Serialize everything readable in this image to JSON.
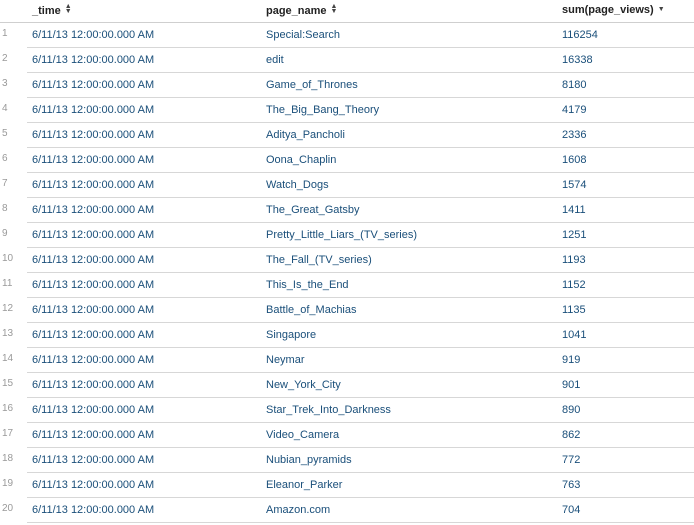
{
  "table": {
    "columns": [
      {
        "label": "_time",
        "sort": "both"
      },
      {
        "label": "page_name",
        "sort": "both"
      },
      {
        "label": "sum(page_views)",
        "sort": "desc"
      }
    ],
    "rows": [
      {
        "num": "1",
        "time": "6/11/13 12:00:00.000 AM",
        "page_name": "Special:Search",
        "views": "116254"
      },
      {
        "num": "2",
        "time": "6/11/13 12:00:00.000 AM",
        "page_name": "edit",
        "views": "16338"
      },
      {
        "num": "3",
        "time": "6/11/13 12:00:00.000 AM",
        "page_name": "Game_of_Thrones",
        "views": "8180"
      },
      {
        "num": "4",
        "time": "6/11/13 12:00:00.000 AM",
        "page_name": "The_Big_Bang_Theory",
        "views": "4179"
      },
      {
        "num": "5",
        "time": "6/11/13 12:00:00.000 AM",
        "page_name": "Aditya_Pancholi",
        "views": "2336"
      },
      {
        "num": "6",
        "time": "6/11/13 12:00:00.000 AM",
        "page_name": "Oona_Chaplin",
        "views": "1608"
      },
      {
        "num": "7",
        "time": "6/11/13 12:00:00.000 AM",
        "page_name": "Watch_Dogs",
        "views": "1574"
      },
      {
        "num": "8",
        "time": "6/11/13 12:00:00.000 AM",
        "page_name": "The_Great_Gatsby",
        "views": "1411"
      },
      {
        "num": "9",
        "time": "6/11/13 12:00:00.000 AM",
        "page_name": "Pretty_Little_Liars_(TV_series)",
        "views": "1251"
      },
      {
        "num": "10",
        "time": "6/11/13 12:00:00.000 AM",
        "page_name": "The_Fall_(TV_series)",
        "views": "1193"
      },
      {
        "num": "11",
        "time": "6/11/13 12:00:00.000 AM",
        "page_name": "This_Is_the_End",
        "views": "1152"
      },
      {
        "num": "12",
        "time": "6/11/13 12:00:00.000 AM",
        "page_name": "Battle_of_Machias",
        "views": "1135"
      },
      {
        "num": "13",
        "time": "6/11/13 12:00:00.000 AM",
        "page_name": "Singapore",
        "views": "1041"
      },
      {
        "num": "14",
        "time": "6/11/13 12:00:00.000 AM",
        "page_name": "Neymar",
        "views": "919"
      },
      {
        "num": "15",
        "time": "6/11/13 12:00:00.000 AM",
        "page_name": "New_York_City",
        "views": "901"
      },
      {
        "num": "16",
        "time": "6/11/13 12:00:00.000 AM",
        "page_name": "Star_Trek_Into_Darkness",
        "views": "890"
      },
      {
        "num": "17",
        "time": "6/11/13 12:00:00.000 AM",
        "page_name": "Video_Camera",
        "views": "862"
      },
      {
        "num": "18",
        "time": "6/11/13 12:00:00.000 AM",
        "page_name": "Nubian_pyramids",
        "views": "772"
      },
      {
        "num": "19",
        "time": "6/11/13 12:00:00.000 AM",
        "page_name": "Eleanor_Parker",
        "views": "763"
      },
      {
        "num": "20",
        "time": "6/11/13 12:00:00.000 AM",
        "page_name": "Amazon.com",
        "views": "704"
      }
    ]
  },
  "colors": {
    "link": "#1a4f7a",
    "row_number": "#999999",
    "divider": "#d7d7d7"
  }
}
